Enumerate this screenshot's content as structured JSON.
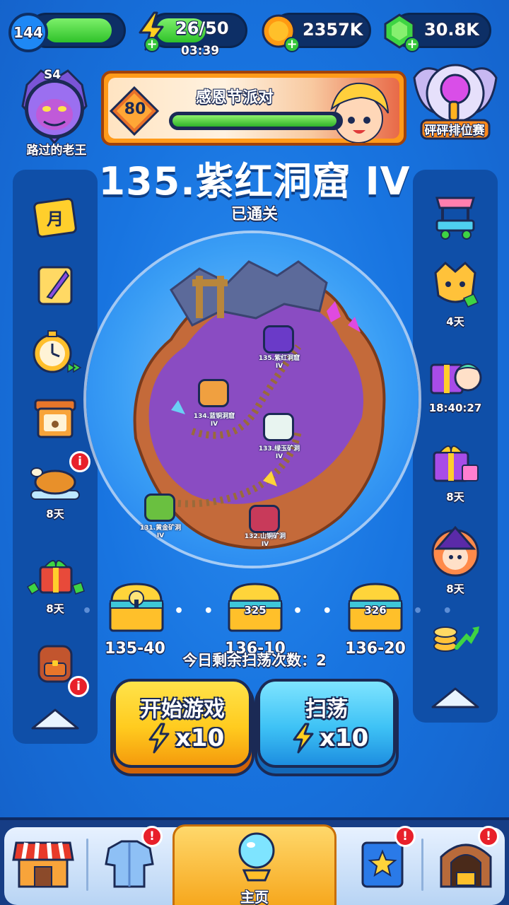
{
  "top_bar": {
    "player_level": "144",
    "energy": "26/50",
    "energy_timer": "03:39",
    "coins": "2357K",
    "gems": "30.8K"
  },
  "profile": {
    "season_badge": "S4",
    "player_name": "路过的老王"
  },
  "event": {
    "level": "80",
    "title": "感恩节派对"
  },
  "rank_event": {
    "label": "砰砰排位赛"
  },
  "stage": {
    "title": "135.紫红洞窟 IV",
    "status": "已通关"
  },
  "map_nodes": [
    {
      "label": "135.紫红洞窟\nIV"
    },
    {
      "label": "134.蓝铜洞窟\nIV"
    },
    {
      "label": "133.绿玉矿洞\nIV"
    },
    {
      "label": "131.黄金矿洞\nIV"
    },
    {
      "label": "132.山铜矿洞\nIV"
    }
  ],
  "left_panel": {
    "items": [
      {
        "name": "monthly-card",
        "label": ""
      },
      {
        "name": "quest-scroll",
        "label": ""
      },
      {
        "name": "speed-up-stopwatch",
        "label": ""
      },
      {
        "name": "pet-house",
        "label": ""
      },
      {
        "name": "thanksgiving-turkey",
        "label": "8天"
      },
      {
        "name": "gift-pack",
        "label": "8天"
      },
      {
        "name": "backpack",
        "label": ""
      }
    ]
  },
  "right_panel": {
    "items": [
      {
        "name": "shop-cart",
        "label": ""
      },
      {
        "name": "golden-fox",
        "label": "4天"
      },
      {
        "name": "hero-gift",
        "label": "18:40:27"
      },
      {
        "name": "puzzle-gift",
        "label": "8天"
      },
      {
        "name": "witch-event",
        "label": "8天"
      },
      {
        "name": "coin-growth",
        "label": ""
      }
    ]
  },
  "chests": [
    {
      "number": "",
      "label": "135-40"
    },
    {
      "number": "325",
      "label": "136-10"
    },
    {
      "number": "326",
      "label": "136-20"
    }
  ],
  "sweep_remaining": "今日剩余扫荡次数：2",
  "buttons": {
    "start_label": "开始游戏",
    "start_cost": "x10",
    "sweep_label": "扫荡",
    "sweep_cost": "x10"
  },
  "bottom_nav": {
    "home_label": "主页"
  },
  "colors": {
    "background": "#1874e0",
    "panel": "#0f4fa8",
    "start_button": "#ffcb1f",
    "sweep_button": "#3ec2f5",
    "badge_red": "#e8202a"
  }
}
